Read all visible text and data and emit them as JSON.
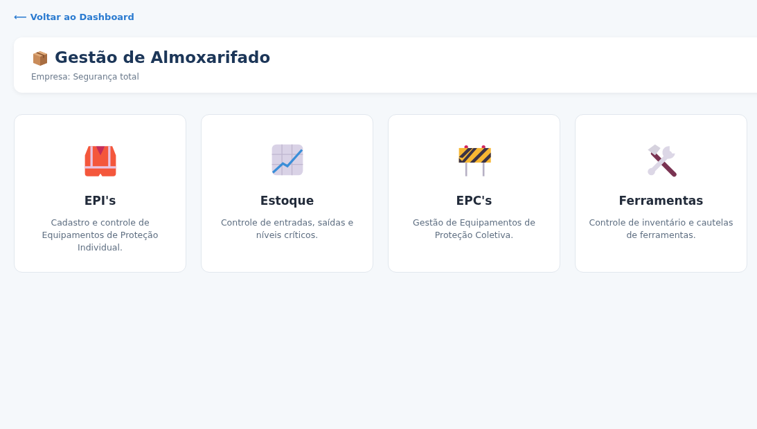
{
  "back_link": {
    "arrow": "⟵",
    "label": "Voltar ao Dashboard"
  },
  "header": {
    "title": "Gestão de Almoxarifado",
    "subtitle": "Empresa: Segurança total"
  },
  "modules": [
    {
      "title": "EPI's",
      "description": "Cadastro e controle de Equipamentos de Proteção Individual."
    },
    {
      "title": "Estoque",
      "description": "Controle de entradas, saídas e níveis críticos."
    },
    {
      "title": "EPC's",
      "description": "Gestão de Equipamentos de Proteção Coletiva."
    },
    {
      "title": "Ferramentas",
      "description": "Controle de inventário e cautelas de ferramentas."
    }
  ]
}
